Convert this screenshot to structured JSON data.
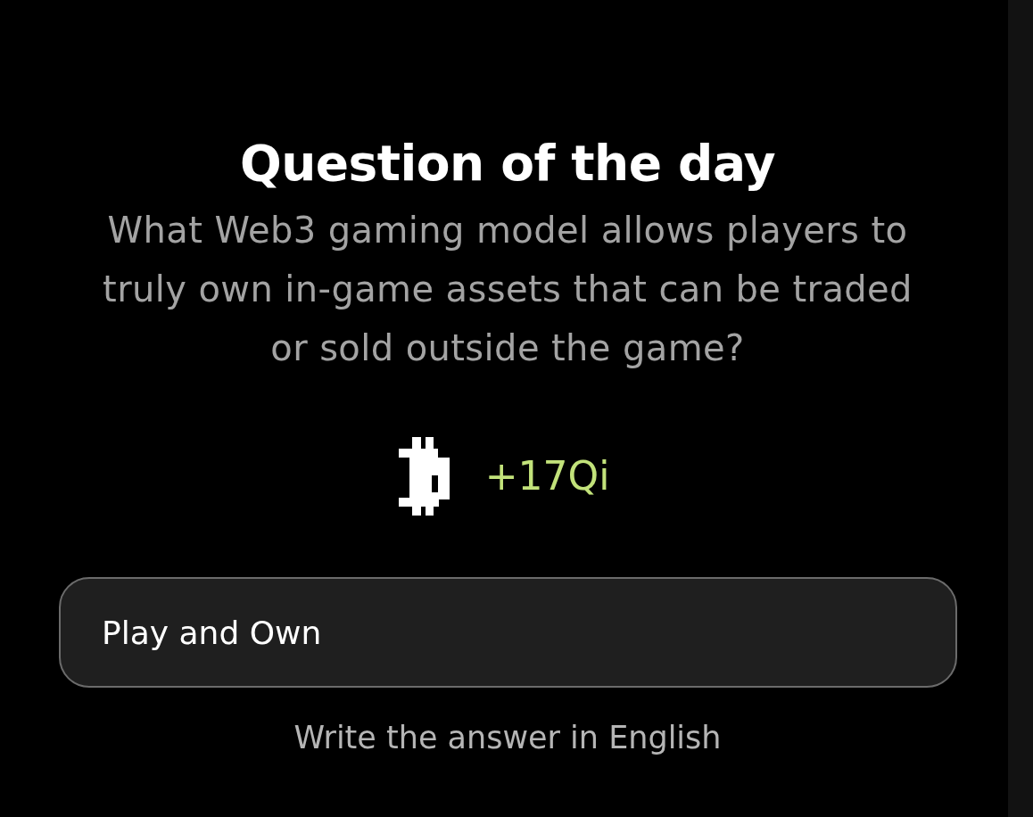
{
  "title": "Question of the day",
  "question": "What Web3 gaming model allows players to truly own in-game assets that can be traded or sold outside the game?",
  "reward": {
    "amount": "+17Qi"
  },
  "answer_field": {
    "value": "Play and Own"
  },
  "hint": "Write the answer in English"
}
